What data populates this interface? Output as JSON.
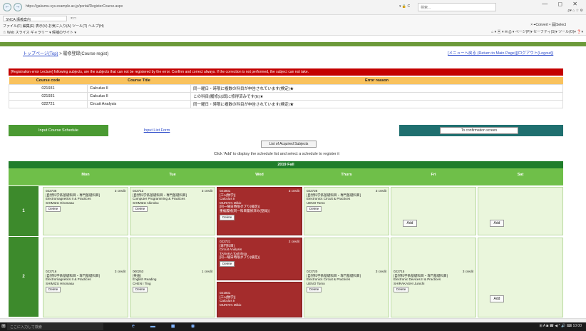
{
  "browser": {
    "url": "https://gakumu-sys.example.ac.jp/portal/RegisterCourse.aspx",
    "controls": "▾ 🔒 C",
    "search_placeholder": "検索...",
    "window_controls": "— ◻ ✕",
    "nav_right": "ρ▾ ⌂ ☆ ⚙",
    "tab1": "SNCA 講義案内",
    "tab2": "× □",
    "menu": "ファイル(F)  編集(E)  表示(V)  お気に入り(A)  ツール(T)  ヘルプ(H)",
    "favorites": "☆ Web スライス ギャラリー ▾   候補のサイト ▾",
    "convert_text": "× ⌖Convert ▾ 🖼Select",
    "toolbar_right": "⌂ ▾ ▣ ▾ ✉ ⎙ ▾ ページ(P)▾ セーフティ(S)▾ ツール(O)▾ ❓▾"
  },
  "page": {
    "breadcrumb_top": "トップページ(Top)",
    "breadcrumb_rest": " > 履修登録(Course regist)",
    "link_return": "[メニューへ戻る (Return to Main Page)]",
    "link_logout": "[ログアウト(Logout)]",
    "error_bar": "[Registration error Lecture] following subjects, are the subjects that can not be registered by the error. Confirm and correct always. If the correction is not performed, the subject can not take.",
    "error_headers": [
      "Course code",
      "Course Title",
      "Error reason"
    ],
    "error_rows": [
      {
        "code": "021931",
        "title": "Calculus II",
        "reason": "同一曜日・時限に複数の科目が申告されています(検定)★"
      },
      {
        "code": "021931",
        "title": "Calculus II",
        "reason": "この科目(履修)は既に修得済みです(E)★"
      },
      {
        "code": "022721",
        "title": "Circuit Analysis",
        "reason": "同一曜日・時限に複数の科目が申告されています(検定)★"
      }
    ],
    "tab_schedule": "Input Course Schedule",
    "tab_list": "Input List Form",
    "confirm_button": "To confirmation screen",
    "list_acquired_button": "List of Acquired Subjects",
    "hint": "Click 'Add' to display the schedule list and select a schedule to register it",
    "term": "2019  Fall",
    "days": [
      "Mon",
      "Tue",
      "Wed",
      "Thurs",
      "Fri",
      "Sat"
    ],
    "periods": [
      "1",
      "2"
    ],
    "delete_label": "Delete",
    "add_label": "Add",
    "p1": {
      "mon": {
        "code": "022736",
        "credit": "3 credit",
        "category": "[自然科学系基礎科目・専門基礎科目]",
        "title": "Electromagnetics II & Practices",
        "teacher": "SHIMIZU Hiromasa"
      },
      "tue": {
        "code": "022712",
        "credit": "3 credit",
        "category": "[自然科学系基礎科目・専門基礎科目]",
        "title": "Computer Programming & Practices",
        "teacher": "SHIMIZU Akinobu"
      },
      "wed": {
        "code": "021931",
        "credit": "3 credit",
        "category": "[工A(数学)]",
        "title": "Calculus II",
        "teacher": "MURATA Mikio",
        "note1": "[同一曜日時限ダブり(検定)]",
        "note2": "重複履修[同一科目履修済み(登録)]"
      },
      "thu": {
        "code": "022726",
        "credit": "3 credit",
        "category": "[自然科学系基礎科目・専門基礎科目]",
        "title": "Electronics Circuit & Practices",
        "teacher": "UENO Tomo"
      }
    },
    "p2": {
      "mon": {
        "code": "022716",
        "credit": "3 credit",
        "category": "[自然科学系基礎科目・専門基礎科目]",
        "title": "Electromagnetics II & Practices",
        "teacher": "SHIMIZU Hiromasa"
      },
      "tue": {
        "code": "000253",
        "credit": "1 credit",
        "category": "[英語]",
        "title": "English Reading",
        "teacher": "CHEN I Ting"
      },
      "wed_a": {
        "code": "022721",
        "credit": "2 credit",
        "category": "[専門科目]",
        "title": "Circuit Analysis",
        "teacher": "TANAKA Toshihisa",
        "note1": "[同一曜日時限ダブり(検定)]"
      },
      "wed_b": {
        "code": "021931",
        "credit": "",
        "category": "[工A(数学)]",
        "title": "Calculus II",
        "teacher": "MURATA Mikio"
      },
      "thu": {
        "code": "022720",
        "credit": "3 credit",
        "category": "[自然科学系基礎科目・専門基礎科目]",
        "title": "Electronics Circuit & Practices",
        "teacher": "UENO Tomo"
      },
      "fri": {
        "code": "022715",
        "credit": "3 credit",
        "category": "[自然科学系基礎科目・専門基礎科目]",
        "title": "Electronic Devices II & Practices",
        "teacher": "SHIRAKASHI Junichi"
      }
    }
  },
  "taskbar": {
    "search": "ここに入力して検索",
    "icons": "e ▬ ◼ ◉",
    "right": "⊞ A ◙ ☎ ◀  ^ 🔊 ⌨  10:00"
  }
}
